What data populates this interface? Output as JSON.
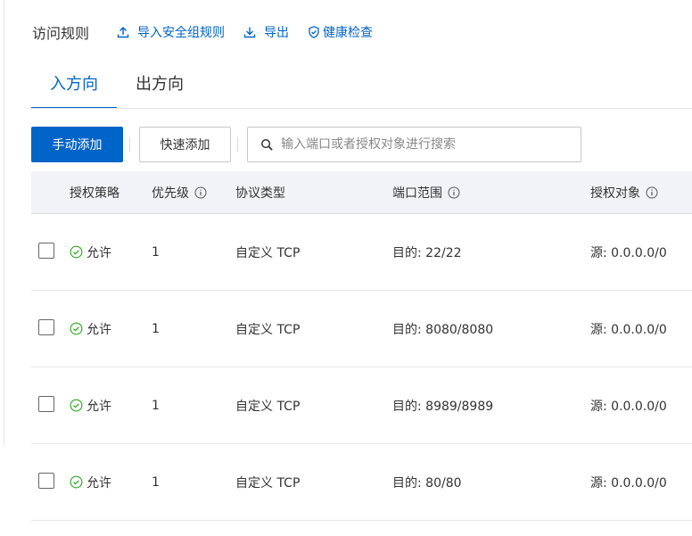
{
  "header": {
    "title": "访问规则",
    "links": {
      "import": "导入安全组规则",
      "export": "导出",
      "health": "健康检查"
    }
  },
  "tabs": [
    {
      "label": "入方向",
      "active": true
    },
    {
      "label": "出方向",
      "active": false
    }
  ],
  "toolbar": {
    "add_manual": "手动添加",
    "add_quick": "快速添加",
    "search_placeholder": "输入端口或者授权对象进行搜索"
  },
  "table": {
    "columns": {
      "policy": "授权策略",
      "priority": "优先级",
      "protocol": "协议类型",
      "port": "端口范围",
      "object": "授权对象"
    },
    "rows": [
      {
        "policy": "允许",
        "priority": "1",
        "protocol": "自定义 TCP",
        "port": "目的: 22/22",
        "object": "源: 0.0.0.0/0"
      },
      {
        "policy": "允许",
        "priority": "1",
        "protocol": "自定义 TCP",
        "port": "目的: 8080/8080",
        "object": "源: 0.0.0.0/0"
      },
      {
        "policy": "允许",
        "priority": "1",
        "protocol": "自定义 TCP",
        "port": "目的: 8989/8989",
        "object": "源: 0.0.0.0/0"
      },
      {
        "policy": "允许",
        "priority": "1",
        "protocol": "自定义 TCP",
        "port": "目的: 80/80",
        "object": "源: 0.0.0.0/0"
      }
    ]
  },
  "colors": {
    "primary": "#0064c8",
    "success": "#2aa71c",
    "header_bg": "#f1f3f6"
  }
}
